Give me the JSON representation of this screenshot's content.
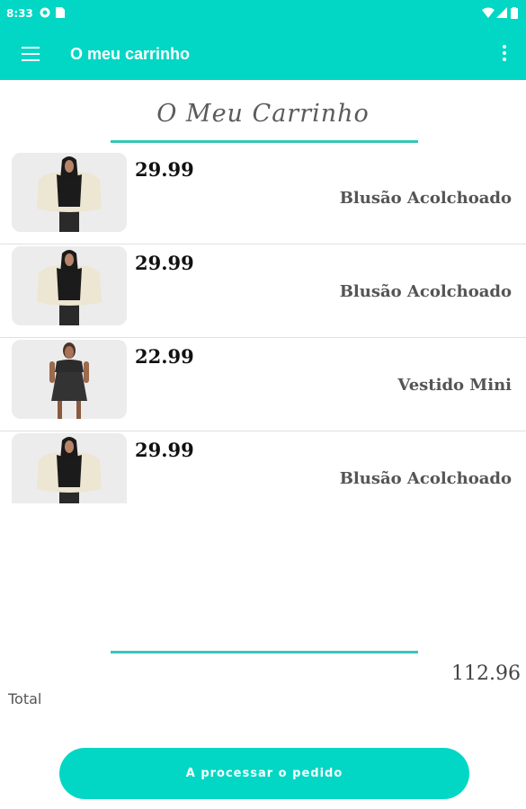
{
  "status_bar": {
    "time": "8:33"
  },
  "app_bar": {
    "title": "O meu carrinho"
  },
  "page": {
    "heading": "O Meu Carrinho"
  },
  "cart": {
    "items": [
      {
        "price": "29.99",
        "name": "Blusão Acolchoado",
        "image": "jacket"
      },
      {
        "price": "29.99",
        "name": "Blusão Acolchoado",
        "image": "jacket"
      },
      {
        "price": "22.99",
        "name": "Vestido Mini",
        "image": "dress"
      },
      {
        "price": "29.99",
        "name": "Blusão Acolchoado",
        "image": "jacket"
      }
    ]
  },
  "total": {
    "label": "Total",
    "value": "112.96"
  },
  "actions": {
    "process_label": "A processar o pedido"
  },
  "colors": {
    "accent": "#01d7c4",
    "divider": "#35c7b7"
  }
}
